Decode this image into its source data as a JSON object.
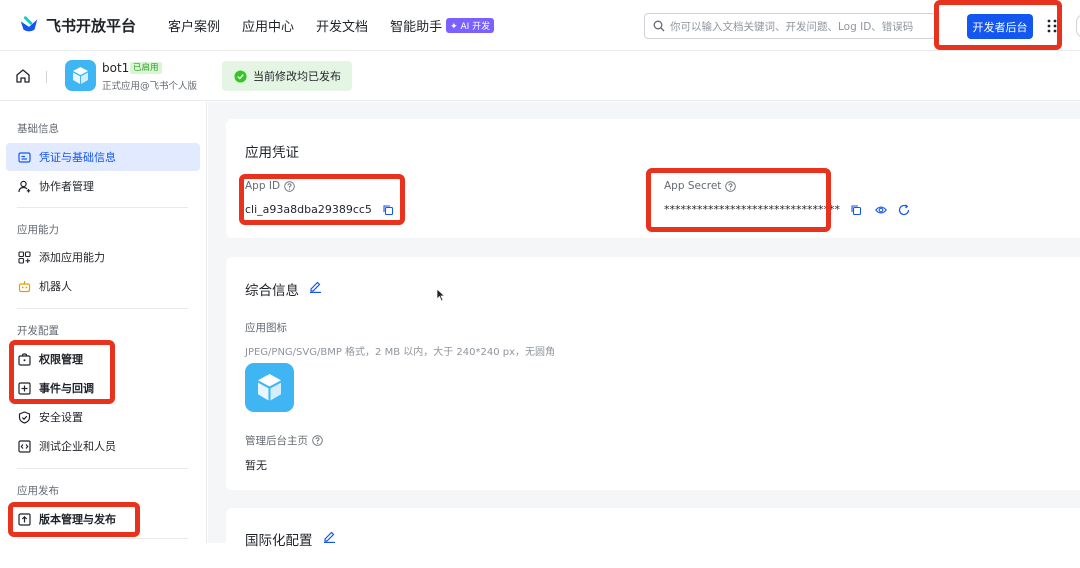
{
  "topbar": {
    "brand": "飞书开放平台",
    "nav": [
      {
        "label": "客户案例"
      },
      {
        "label": "应用中心"
      },
      {
        "label": "开发文档"
      },
      {
        "label": "智能助手"
      }
    ],
    "ai_badge": "✦ AI 开发",
    "search_placeholder": "你可以输入文档关键词、开发问题、Log ID、错误码",
    "dev_console_label": "开发者后台"
  },
  "app_header": {
    "name": "bot1",
    "status_badge": "已启用",
    "subtitle": "正式应用@飞书个人版",
    "toast": "当前修改均已发布"
  },
  "sidebar": {
    "sections": [
      {
        "title": "基础信息",
        "items": [
          {
            "label": "凭证与基础信息",
            "icon": "id-card-icon",
            "active": true
          },
          {
            "label": "协作者管理",
            "icon": "user-add-icon"
          }
        ]
      },
      {
        "title": "应用能力",
        "items": [
          {
            "label": "添加应用能力",
            "icon": "grid-add-icon"
          },
          {
            "label": "机器人",
            "icon": "robot-icon"
          }
        ]
      },
      {
        "title": "开发配置",
        "items": [
          {
            "label": "权限管理",
            "icon": "lock-box-icon"
          },
          {
            "label": "事件与回调",
            "icon": "event-icon"
          },
          {
            "label": "安全设置",
            "icon": "shield-icon"
          },
          {
            "label": "测试企业和人员",
            "icon": "code-icon"
          }
        ]
      },
      {
        "title": "应用发布",
        "items": [
          {
            "label": "版本管理与发布",
            "icon": "upload-box-icon"
          }
        ]
      }
    ]
  },
  "credentials": {
    "title": "应用凭证",
    "app_id_label": "App ID",
    "app_id_value": "cli_a93a8dba29389cc5",
    "app_secret_label": "App Secret",
    "app_secret_value": "********************************"
  },
  "general_info": {
    "title": "综合信息",
    "icon_label": "应用图标",
    "icon_hint": "JPEG/PNG/SVG/BMP 格式，2 MB 以内，大于 240*240 px，无圆角",
    "homepage_label": "管理后台主页",
    "homepage_value": "暂无"
  },
  "i18n": {
    "title": "国际化配置"
  },
  "colors": {
    "accent": "#1456f0",
    "annotation": "#e8321e",
    "app_icon": "#3fb5f4"
  }
}
